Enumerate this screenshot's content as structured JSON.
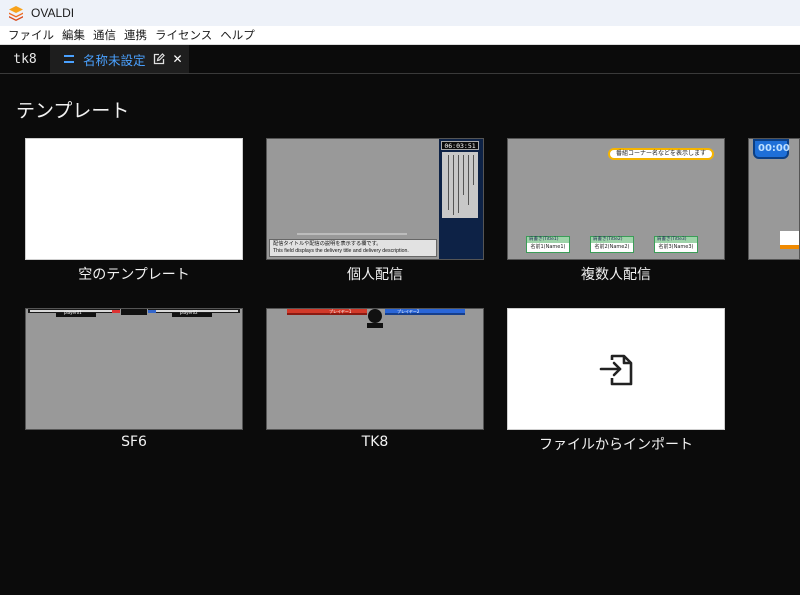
{
  "app": {
    "title": "OVALDI"
  },
  "menu": [
    "ファイル",
    "編集",
    "通信",
    "連携",
    "ライセンス",
    "ヘルプ"
  ],
  "tabs": {
    "inactive": "tk8",
    "active": "名称未設定"
  },
  "section_title": "テンプレート",
  "colors": {
    "accent": "#4aa1ff",
    "background": "#0b0b0b",
    "thumb_gray": "#999999"
  },
  "templates": [
    {
      "name": "空のテンプレート",
      "icon": "blank"
    },
    {
      "name": "個人配信",
      "preview": {
        "clock": "06:03:51",
        "vertical_text": "配信者のメッセージや告知などを表示するスペースです。This space is to display messages and other information.",
        "desc_ja": "配信タイトルや配信の説明を表示する欄です。",
        "desc_en": "This field displays the delivery title and delivery description."
      }
    },
    {
      "name": "複数人配信",
      "preview": {
        "banner": "番組コーナー名などを表示します",
        "names": [
          "名前1(Name1)",
          "名前2(Name2)",
          "名前3(Name3)"
        ],
        "headers": [
          "肩書き(Title1)",
          "肩書き(Title2)",
          "肩書き(Title3)"
        ]
      }
    },
    {
      "name": "SF6",
      "preview": {
        "p1": "player01",
        "p2": "player02"
      }
    },
    {
      "name": "TK8",
      "preview": {
        "p1": "プレイヤー1",
        "p2": "プレイヤー2"
      }
    },
    {
      "name": "ファイルからインポート",
      "icon": "file-import"
    }
  ],
  "partial_template": {
    "clock": "00:00"
  }
}
